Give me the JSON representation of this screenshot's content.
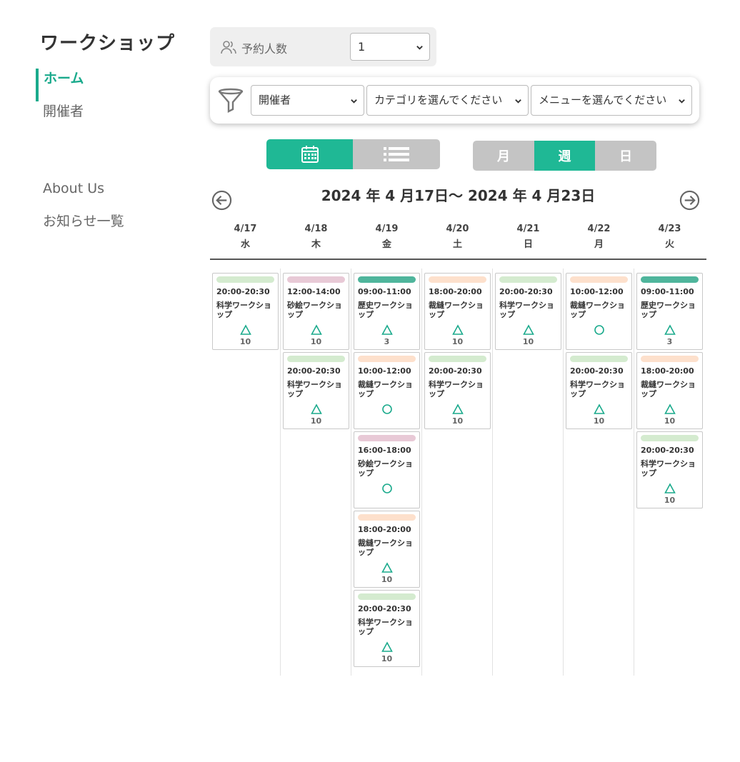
{
  "app_title": "ワークショップ",
  "nav": {
    "items": [
      {
        "label": "ホーム",
        "active": true
      },
      {
        "label": "開催者",
        "active": false
      }
    ],
    "bottom_items": [
      {
        "label": "About Us"
      },
      {
        "label": "お知らせ一覧"
      }
    ]
  },
  "party": {
    "label": "予約人数",
    "value": "1"
  },
  "filters": {
    "organizer": "開催者",
    "category": "カテゴリを選んでください",
    "menu": "メニューを選んでください"
  },
  "view_toggle": {
    "calendar_icon": "calendar-icon",
    "list_icon": "list-icon",
    "active": "calendar"
  },
  "range_toggle": {
    "month": "月",
    "week": "週",
    "day": "日",
    "active": "week"
  },
  "date_range": "2024 年 4 月17日〜 2024 年 4 月23日",
  "colors": {
    "accent": "#1fb895",
    "green_light": "#d4ebcf",
    "pink": "#e8c9d6",
    "teal": "#4fb59c",
    "peach": "#fde0cc",
    "status": "#1aaa8c"
  },
  "days": [
    {
      "date": "4/17",
      "weekday": "水",
      "events": [
        {
          "time": "20:00-20:30",
          "title": "科学ワークショップ",
          "status": "△",
          "count": "10",
          "color": "#d4ebcf"
        }
      ]
    },
    {
      "date": "4/18",
      "weekday": "木",
      "events": [
        {
          "time": "12:00-14:00",
          "title": "砂絵ワークショップ",
          "status": "△",
          "count": "10",
          "color": "#e8c9d6"
        },
        {
          "time": "20:00-20:30",
          "title": "科学ワークショップ",
          "status": "△",
          "count": "10",
          "color": "#d4ebcf"
        }
      ]
    },
    {
      "date": "4/19",
      "weekday": "金",
      "events": [
        {
          "time": "09:00-11:00",
          "title": "歴史ワークショップ",
          "status": "△",
          "count": "3",
          "color": "#4fb59c"
        },
        {
          "time": "10:00-12:00",
          "title": "裁縫ワークショップ",
          "status": "○",
          "count": "",
          "color": "#fde0cc"
        },
        {
          "time": "16:00-18:00",
          "title": "砂絵ワークショップ",
          "status": "○",
          "count": "",
          "color": "#e8c9d6"
        },
        {
          "time": "18:00-20:00",
          "title": "裁縫ワークショップ",
          "status": "△",
          "count": "10",
          "color": "#fde0cc"
        },
        {
          "time": "20:00-20:30",
          "title": "科学ワークショップ",
          "status": "△",
          "count": "10",
          "color": "#d4ebcf"
        }
      ]
    },
    {
      "date": "4/20",
      "weekday": "土",
      "events": [
        {
          "time": "18:00-20:00",
          "title": "裁縫ワークショップ",
          "status": "△",
          "count": "10",
          "color": "#fde0cc"
        },
        {
          "time": "20:00-20:30",
          "title": "科学ワークショップ",
          "status": "△",
          "count": "10",
          "color": "#d4ebcf"
        }
      ]
    },
    {
      "date": "4/21",
      "weekday": "日",
      "events": [
        {
          "time": "20:00-20:30",
          "title": "科学ワークショップ",
          "status": "△",
          "count": "10",
          "color": "#d4ebcf"
        }
      ]
    },
    {
      "date": "4/22",
      "weekday": "月",
      "events": [
        {
          "time": "10:00-12:00",
          "title": "裁縫ワークショップ",
          "status": "○",
          "count": "",
          "color": "#fde0cc"
        },
        {
          "time": "20:00-20:30",
          "title": "科学ワークショップ",
          "status": "△",
          "count": "10",
          "color": "#d4ebcf"
        }
      ]
    },
    {
      "date": "4/23",
      "weekday": "火",
      "events": [
        {
          "time": "09:00-11:00",
          "title": "歴史ワークショップ",
          "status": "△",
          "count": "3",
          "color": "#4fb59c"
        },
        {
          "time": "18:00-20:00",
          "title": "裁縫ワークショップ",
          "status": "△",
          "count": "10",
          "color": "#fde0cc"
        },
        {
          "time": "20:00-20:30",
          "title": "科学ワークショップ",
          "status": "△",
          "count": "10",
          "color": "#d4ebcf"
        }
      ]
    }
  ]
}
